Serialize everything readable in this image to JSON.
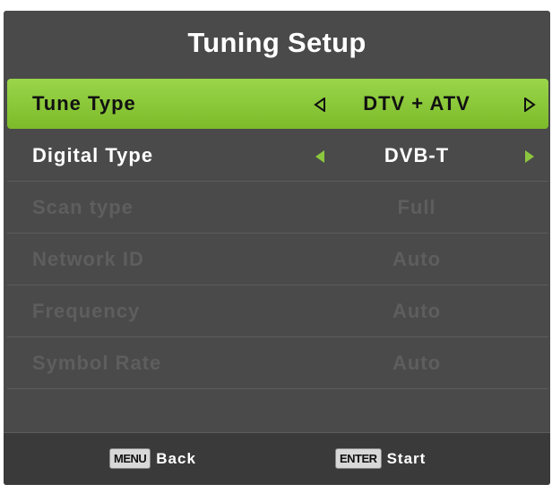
{
  "title": "Tuning Setup",
  "rows": [
    {
      "label": "Tune Type",
      "value": "DTV + ATV",
      "state": "selected"
    },
    {
      "label": "Digital Type",
      "value": "DVB-T",
      "state": "normal"
    },
    {
      "label": "Scan type",
      "value": "Full",
      "state": "disabled"
    },
    {
      "label": "Network ID",
      "value": "Auto",
      "state": "disabled"
    },
    {
      "label": "Frequency",
      "value": "Auto",
      "state": "disabled"
    },
    {
      "label": "Symbol Rate",
      "value": "Auto",
      "state": "disabled"
    }
  ],
  "footer": {
    "menu_key": "MENU",
    "menu_action": "Back",
    "enter_key": "ENTER",
    "enter_action": "Start"
  },
  "colors": {
    "panel": "#4a4a4a",
    "selected_row": "#8cc63f",
    "accent_arrow": "#8cc63f"
  }
}
